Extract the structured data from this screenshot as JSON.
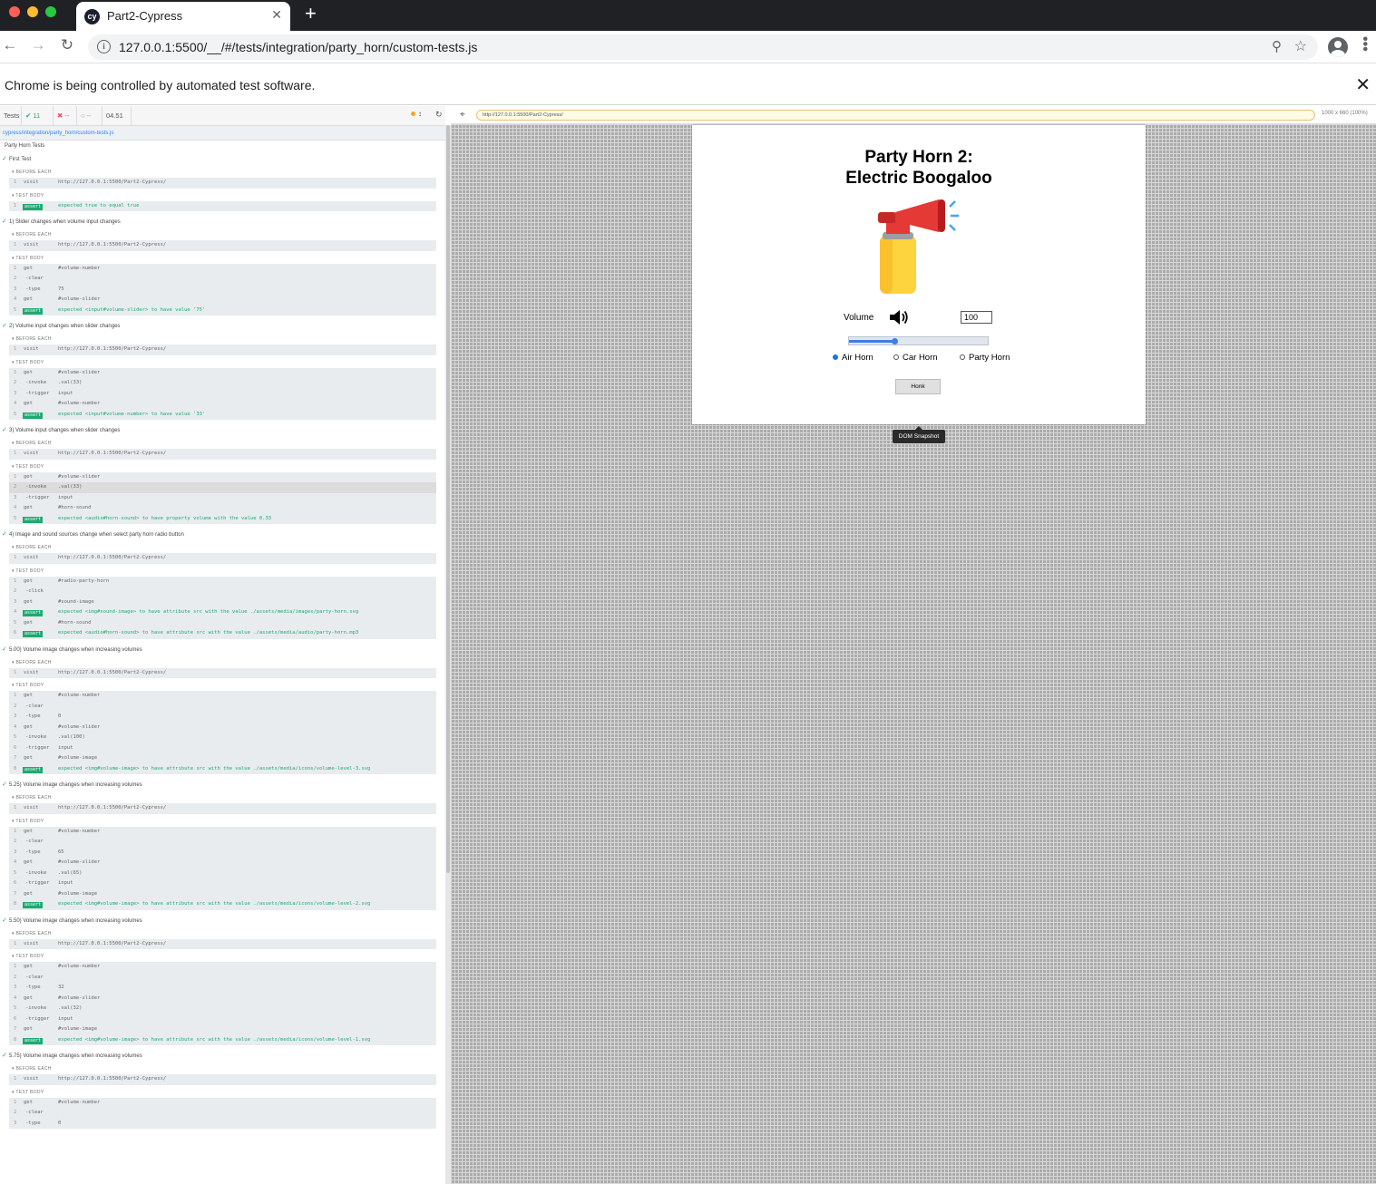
{
  "browser": {
    "tab_title": "Part2-Cypress",
    "tab_favicon": "cy",
    "url": "127.0.0.1:5500/__/#/tests/integration/party_horn/custom-tests.js",
    "infobar_message": "Chrome is being controlled by automated test software."
  },
  "reporter": {
    "tests_label": "Tests",
    "passed": "11",
    "failed": "--",
    "pending": "--",
    "duration": "04.51",
    "spec_path": "cypress/integration/party_horn/custom-tests.js",
    "suite": "Party Horn Tests",
    "hooks": {
      "before": "BEFORE EACH",
      "body": "TEST BODY"
    },
    "tests": [
      {
        "title": "First Test",
        "before": [
          {
            "n": "1",
            "k": "visit",
            "v": "http://127.0.0.1:5500/Part2-Cypress/"
          }
        ],
        "body": [
          {
            "n": "1",
            "k": "assert",
            "v": "expected true to equal true",
            "assert": true
          }
        ]
      },
      {
        "title": "1) Slider changes when volume input changes",
        "before": [
          {
            "n": "1",
            "k": "visit",
            "v": "http://127.0.0.1:5500/Part2-Cypress/"
          }
        ],
        "body": [
          {
            "n": "1",
            "k": "get",
            "v": "#volume-number"
          },
          {
            "n": "2",
            "k": "-clear",
            "v": "",
            "sub": true
          },
          {
            "n": "3",
            "k": "-type",
            "v": "75",
            "sub": true
          },
          {
            "n": "4",
            "k": "get",
            "v": "#volume-slider"
          },
          {
            "n": "5",
            "k": "assert",
            "v": "expected <input#volume-slider> to have value '75'",
            "assert": true
          }
        ]
      },
      {
        "title": "2) Volume input changes when slider changes",
        "before": [
          {
            "n": "1",
            "k": "visit",
            "v": "http://127.0.0.1:5500/Part2-Cypress/"
          }
        ],
        "body": [
          {
            "n": "1",
            "k": "get",
            "v": "#volume-slider"
          },
          {
            "n": "2",
            "k": "-invoke",
            "v": ".val(33)",
            "sub": true
          },
          {
            "n": "3",
            "k": "-trigger",
            "v": "input",
            "sub": true
          },
          {
            "n": "4",
            "k": "get",
            "v": "#volume-number"
          },
          {
            "n": "5",
            "k": "assert",
            "v": "expected <input#volume-number> to have value '33'",
            "assert": true
          }
        ]
      },
      {
        "title": "3) Volume input changes when slider changes",
        "before": [
          {
            "n": "1",
            "k": "visit",
            "v": "http://127.0.0.1:5500/Part2-Cypress/"
          }
        ],
        "body": [
          {
            "n": "1",
            "k": "get",
            "v": "#volume-slider"
          },
          {
            "n": "2",
            "k": "-invoke",
            "v": ".val(33)",
            "sub": true,
            "hl": true
          },
          {
            "n": "3",
            "k": "-trigger",
            "v": "input",
            "sub": true
          },
          {
            "n": "4",
            "k": "get",
            "v": "#horn-sound"
          },
          {
            "n": "5",
            "k": "assert",
            "v": "expected <audio#horn-sound> to have property volume with the value 0.33",
            "assert": true
          }
        ]
      },
      {
        "title": "4) Image and sound sources change when select party horn radio button",
        "before": [
          {
            "n": "1",
            "k": "visit",
            "v": "http://127.0.0.1:5500/Part2-Cypress/"
          }
        ],
        "body": [
          {
            "n": "1",
            "k": "get",
            "v": "#radio-party-horn"
          },
          {
            "n": "2",
            "k": "-click",
            "v": "",
            "sub": true
          },
          {
            "n": "3",
            "k": "get",
            "v": "#sound-image"
          },
          {
            "n": "4",
            "k": "assert",
            "v": "expected <img#sound-image> to have attribute src with the value ./assets/media/images/party-horn.svg",
            "assert": true
          },
          {
            "n": "5",
            "k": "get",
            "v": "#horn-sound"
          },
          {
            "n": "6",
            "k": "assert",
            "v": "expected <audio#horn-sound> to have attribute src with the value ./assets/media/audio/party-horn.mp3",
            "assert": true
          }
        ]
      },
      {
        "title": "5.00) Volume image changes when increasing volumes",
        "before": [
          {
            "n": "1",
            "k": "visit",
            "v": "http://127.0.0.1:5500/Part2-Cypress/"
          }
        ],
        "body": [
          {
            "n": "1",
            "k": "get",
            "v": "#volume-number"
          },
          {
            "n": "2",
            "k": "-clear",
            "v": "",
            "sub": true
          },
          {
            "n": "3",
            "k": "-type",
            "v": "0",
            "sub": true
          },
          {
            "n": "4",
            "k": "get",
            "v": "#volume-slider"
          },
          {
            "n": "5",
            "k": "-invoke",
            "v": ".val(100)",
            "sub": true
          },
          {
            "n": "6",
            "k": "-trigger",
            "v": "input",
            "sub": true
          },
          {
            "n": "7",
            "k": "get",
            "v": "#volume-image"
          },
          {
            "n": "8",
            "k": "assert",
            "v": "expected <img#volume-image> to have attribute src with the value ./assets/media/icons/volume-level-3.svg",
            "assert": true
          }
        ]
      },
      {
        "title": "5.25) Volume image changes when increasing volumes",
        "before": [
          {
            "n": "1",
            "k": "visit",
            "v": "http://127.0.0.1:5500/Part2-Cypress/"
          }
        ],
        "body": [
          {
            "n": "1",
            "k": "get",
            "v": "#volume-number"
          },
          {
            "n": "2",
            "k": "-clear",
            "v": "",
            "sub": true
          },
          {
            "n": "3",
            "k": "-type",
            "v": "65",
            "sub": true
          },
          {
            "n": "4",
            "k": "get",
            "v": "#volume-slider"
          },
          {
            "n": "5",
            "k": "-invoke",
            "v": ".val(65)",
            "sub": true
          },
          {
            "n": "6",
            "k": "-trigger",
            "v": "input",
            "sub": true
          },
          {
            "n": "7",
            "k": "get",
            "v": "#volume-image"
          },
          {
            "n": "8",
            "k": "assert",
            "v": "expected <img#volume-image> to have attribute src with the value ./assets/media/icons/volume-level-2.svg",
            "assert": true
          }
        ]
      },
      {
        "title": "5.50) Volume image changes when increasing volumes",
        "before": [
          {
            "n": "1",
            "k": "visit",
            "v": "http://127.0.0.1:5500/Part2-Cypress/"
          }
        ],
        "body": [
          {
            "n": "1",
            "k": "get",
            "v": "#volume-number"
          },
          {
            "n": "2",
            "k": "-clear",
            "v": "",
            "sub": true
          },
          {
            "n": "3",
            "k": "-type",
            "v": "32",
            "sub": true
          },
          {
            "n": "4",
            "k": "get",
            "v": "#volume-slider"
          },
          {
            "n": "5",
            "k": "-invoke",
            "v": ".val(32)",
            "sub": true
          },
          {
            "n": "6",
            "k": "-trigger",
            "v": "input",
            "sub": true
          },
          {
            "n": "7",
            "k": "get",
            "v": "#volume-image"
          },
          {
            "n": "8",
            "k": "assert",
            "v": "expected <img#volume-image> to have attribute src with the value ./assets/media/icons/volume-level-1.svg",
            "assert": true
          }
        ]
      },
      {
        "title": "5.75) Volume image changes when increasing volumes",
        "before": [
          {
            "n": "1",
            "k": "visit",
            "v": "http://127.0.0.1:5500/Part2-Cypress/"
          }
        ],
        "body": [
          {
            "n": "1",
            "k": "get",
            "v": "#volume-number"
          },
          {
            "n": "2",
            "k": "-clear",
            "v": "",
            "sub": true
          },
          {
            "n": "3",
            "k": "-type",
            "v": "0",
            "sub": true
          }
        ]
      }
    ]
  },
  "preview": {
    "url": "http://127.0.0.1:5500/Part2-Cypress/",
    "viewport": "1000 x 660",
    "zoom": "(100%)",
    "snapshot_label": "DOM Snapshot"
  },
  "aut": {
    "title_line1": "Party Horn 2:",
    "title_line2": "Electric Boogaloo",
    "volume_label": "Volume",
    "volume_value": "100",
    "slider_fraction": 0.33,
    "radios": [
      {
        "label": "Air Horn",
        "checked": true
      },
      {
        "label": "Car Horn",
        "checked": false
      },
      {
        "label": "Party Horn",
        "checked": false
      }
    ],
    "honk_label": "Honk"
  }
}
